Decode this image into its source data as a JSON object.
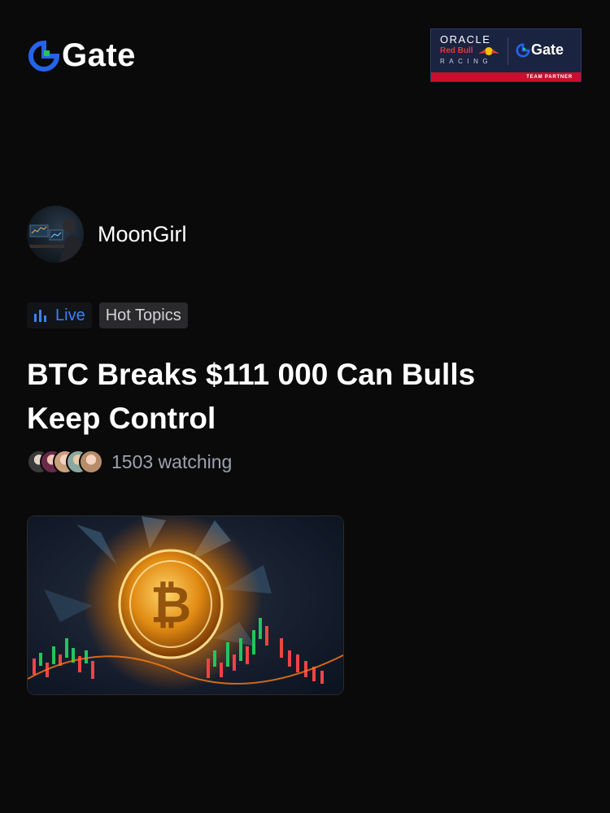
{
  "brand": {
    "name": "Gate",
    "accent": "#2563eb",
    "icon": "gate-logo-icon"
  },
  "partner": {
    "line1": "ORACLE",
    "line2": "Red Bull",
    "line3": "RACING",
    "brand": "Gate",
    "badge": "TEAM PARTNER"
  },
  "host": {
    "name": "MoonGirl",
    "avatar": "trader-avatar"
  },
  "tags": {
    "live_label": "Live",
    "live_icon": "bar-chart-icon",
    "topic_label": "Hot Topics"
  },
  "post": {
    "title": "BTC Breaks $111 000  Can Bulls Keep Control",
    "watching": "1503 watching"
  },
  "thumbnail": {
    "subject": "bitcoin-coin-image"
  },
  "colors": {
    "background": "#0a0a0a",
    "live_blue": "#3b82f6",
    "muted": "#9ca3af"
  }
}
